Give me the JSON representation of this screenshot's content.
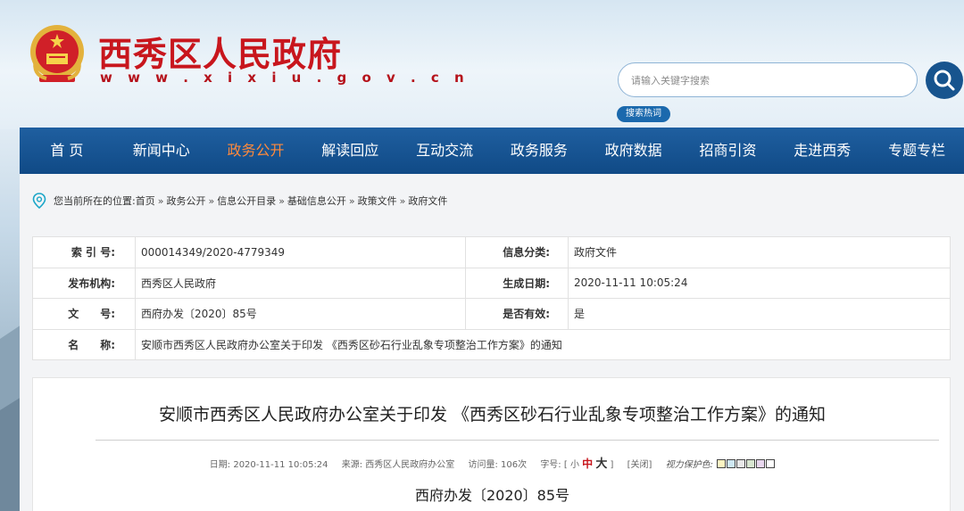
{
  "header": {
    "site_title": "西秀区人民政府",
    "site_url": "w w w . x i x i u . g o v . c n",
    "search_placeholder": "请输入关键字搜索",
    "hot_search_label": "搜索热词",
    "emblem_icon": "national-emblem-icon",
    "search_icon": "search-icon"
  },
  "nav": {
    "items": [
      "首 页",
      "新闻中心",
      "政务公开",
      "解读回应",
      "互动交流",
      "政务服务",
      "政府数据",
      "招商引资",
      "走进西秀",
      "专题专栏"
    ],
    "active_index": 2
  },
  "breadcrumb": {
    "prefix": "您当前所在的位置:",
    "items": [
      "首页",
      "政务公开",
      "信息公开目录",
      "基础信息公开",
      "政策文件",
      "政府文件"
    ],
    "separator": "»",
    "pin_icon": "location-pin-icon"
  },
  "meta": {
    "index_label": "索 引 号:",
    "index_value": "000014349/2020-4779349",
    "category_label": "信息分类:",
    "category_value": "政府文件",
    "publisher_label": "发布机构:",
    "publisher_value": "西秀区人民政府",
    "date_label": "生成日期:",
    "date_value": "2020-11-11 10:05:24",
    "docno_label": "文　　号:",
    "docno_value": "西府办发〔2020〕85号",
    "valid_label": "是否有效:",
    "valid_value": "是",
    "name_label": "名　　称:",
    "name_value": "安顺市西秀区人民政府办公室关于印发 《西秀区砂石行业乱象专项整治工作方案》的通知"
  },
  "document": {
    "title": "安顺市西秀区人民政府办公室关于印发 《西秀区砂石行业乱象专项整治工作方案》的通知",
    "date": "日期: 2020-11-11 10:05:24",
    "source": "来源: 西秀区人民政府办公室",
    "visits": "访问量: 106次",
    "font_size_label": "字号: [",
    "font_small": "小",
    "font_medium": "中",
    "font_large": "大",
    "font_size_close": "]",
    "close_label": "[关闭]",
    "eye_care_label": "视力保护色:",
    "swatch_colors": [
      "#fdf5c3",
      "#cfe8f3",
      "#e8e8e8",
      "#d9e6d1",
      "#e8d7ee",
      "#ffffff"
    ],
    "doc_number": "西府办发〔2020〕85号"
  },
  "colors": {
    "nav_bg": "#135390",
    "nav_active": "#ff8a3c",
    "title_red": "#c8161d"
  }
}
